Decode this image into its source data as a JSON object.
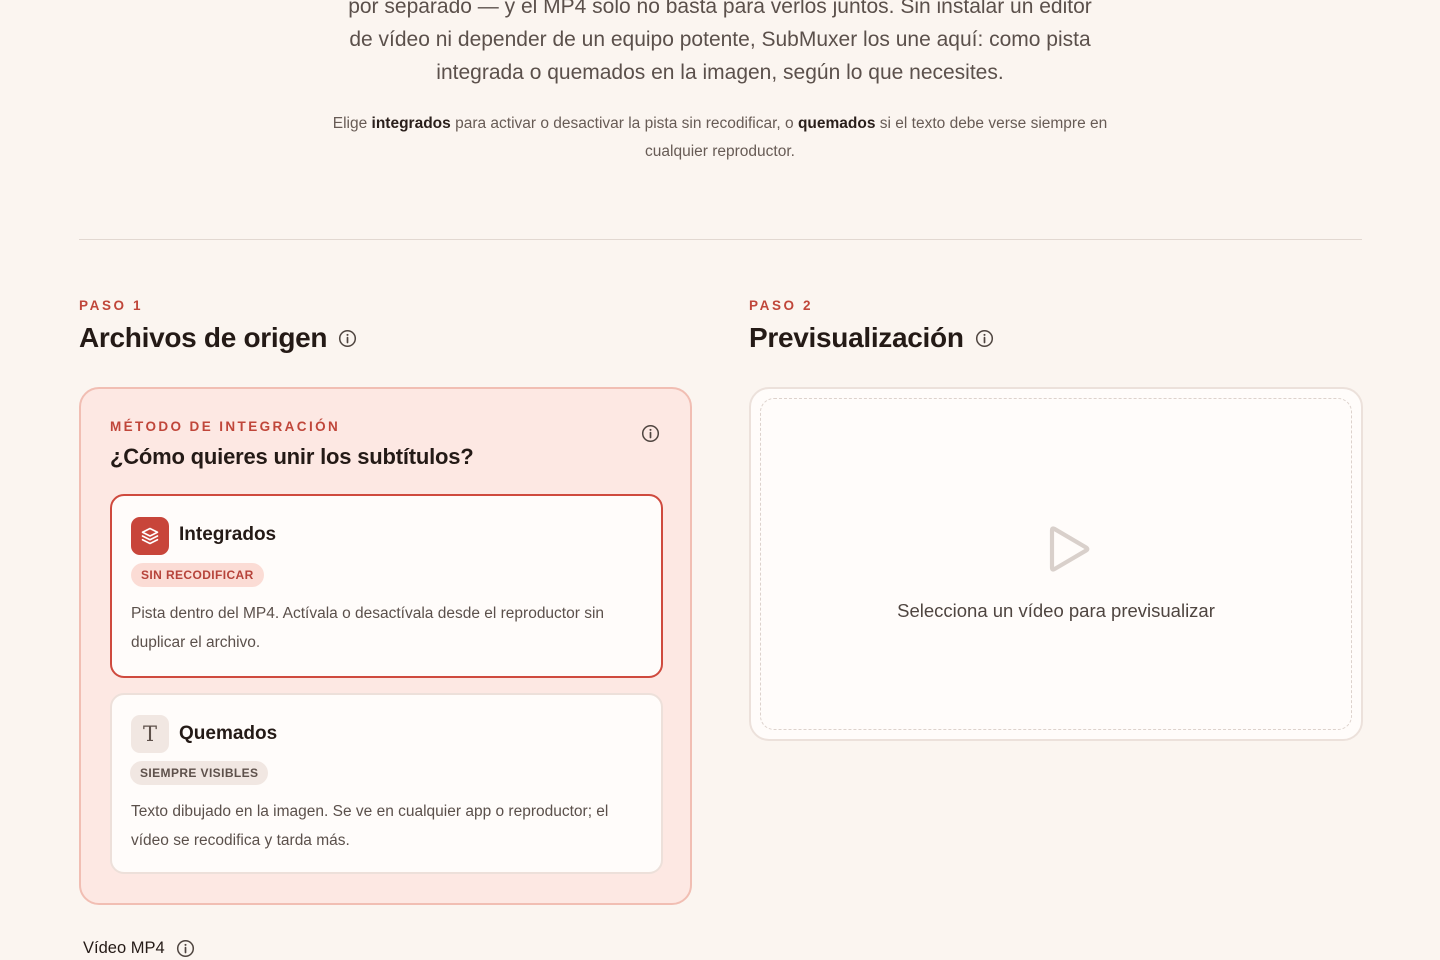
{
  "intro": {
    "lead_lines": [
      "por separado — y el MP4 solo no basta para verlos juntos. Sin instalar un editor",
      "de vídeo ni depender de un equipo potente, SubMuxer los une aquí: como pista",
      "integrada o quemados en la imagen, según lo que necesites."
    ],
    "hint_1": "Elige ",
    "hint_strong_1": "integrados",
    "hint_2": " para activar o desactivar la pista sin recodificar, o ",
    "hint_strong_2": "quemados",
    "hint_3": " si el texto debe verse siempre en cualquier reproductor."
  },
  "step1": {
    "label": "PASO 1",
    "title": "Archivos de origen"
  },
  "step2": {
    "label": "PASO 2",
    "title": "Previsualización"
  },
  "method": {
    "kicker": "MÉTODO DE INTEGRACIÓN",
    "question": "¿Cómo quieres unir los subtítulos?",
    "options": [
      {
        "title": "Integrados",
        "badge": "SIN RECODIFICAR",
        "description": "Pista dentro del MP4. Actívala o desactívala desde el reproductor sin duplicar el archivo.",
        "icon": "layers-icon",
        "selected": true
      },
      {
        "title": "Quemados",
        "badge": "SIEMPRE VISIBLES",
        "description": "Texto dibujado en la imagen. Se ve en cualquier app o reproductor; el vídeo se recodifica y tarda más.",
        "icon_glyph": "T",
        "icon": "text-icon",
        "selected": false
      }
    ]
  },
  "preview": {
    "empty_text": "Selecciona un vídeo para previsualizar",
    "icon": "play-icon"
  },
  "fields": {
    "video_label": "Vídeo MP4"
  },
  "colors": {
    "accent": "#c8453a",
    "background": "#fbf5f0",
    "method_card_bg": "#fde8e3"
  }
}
